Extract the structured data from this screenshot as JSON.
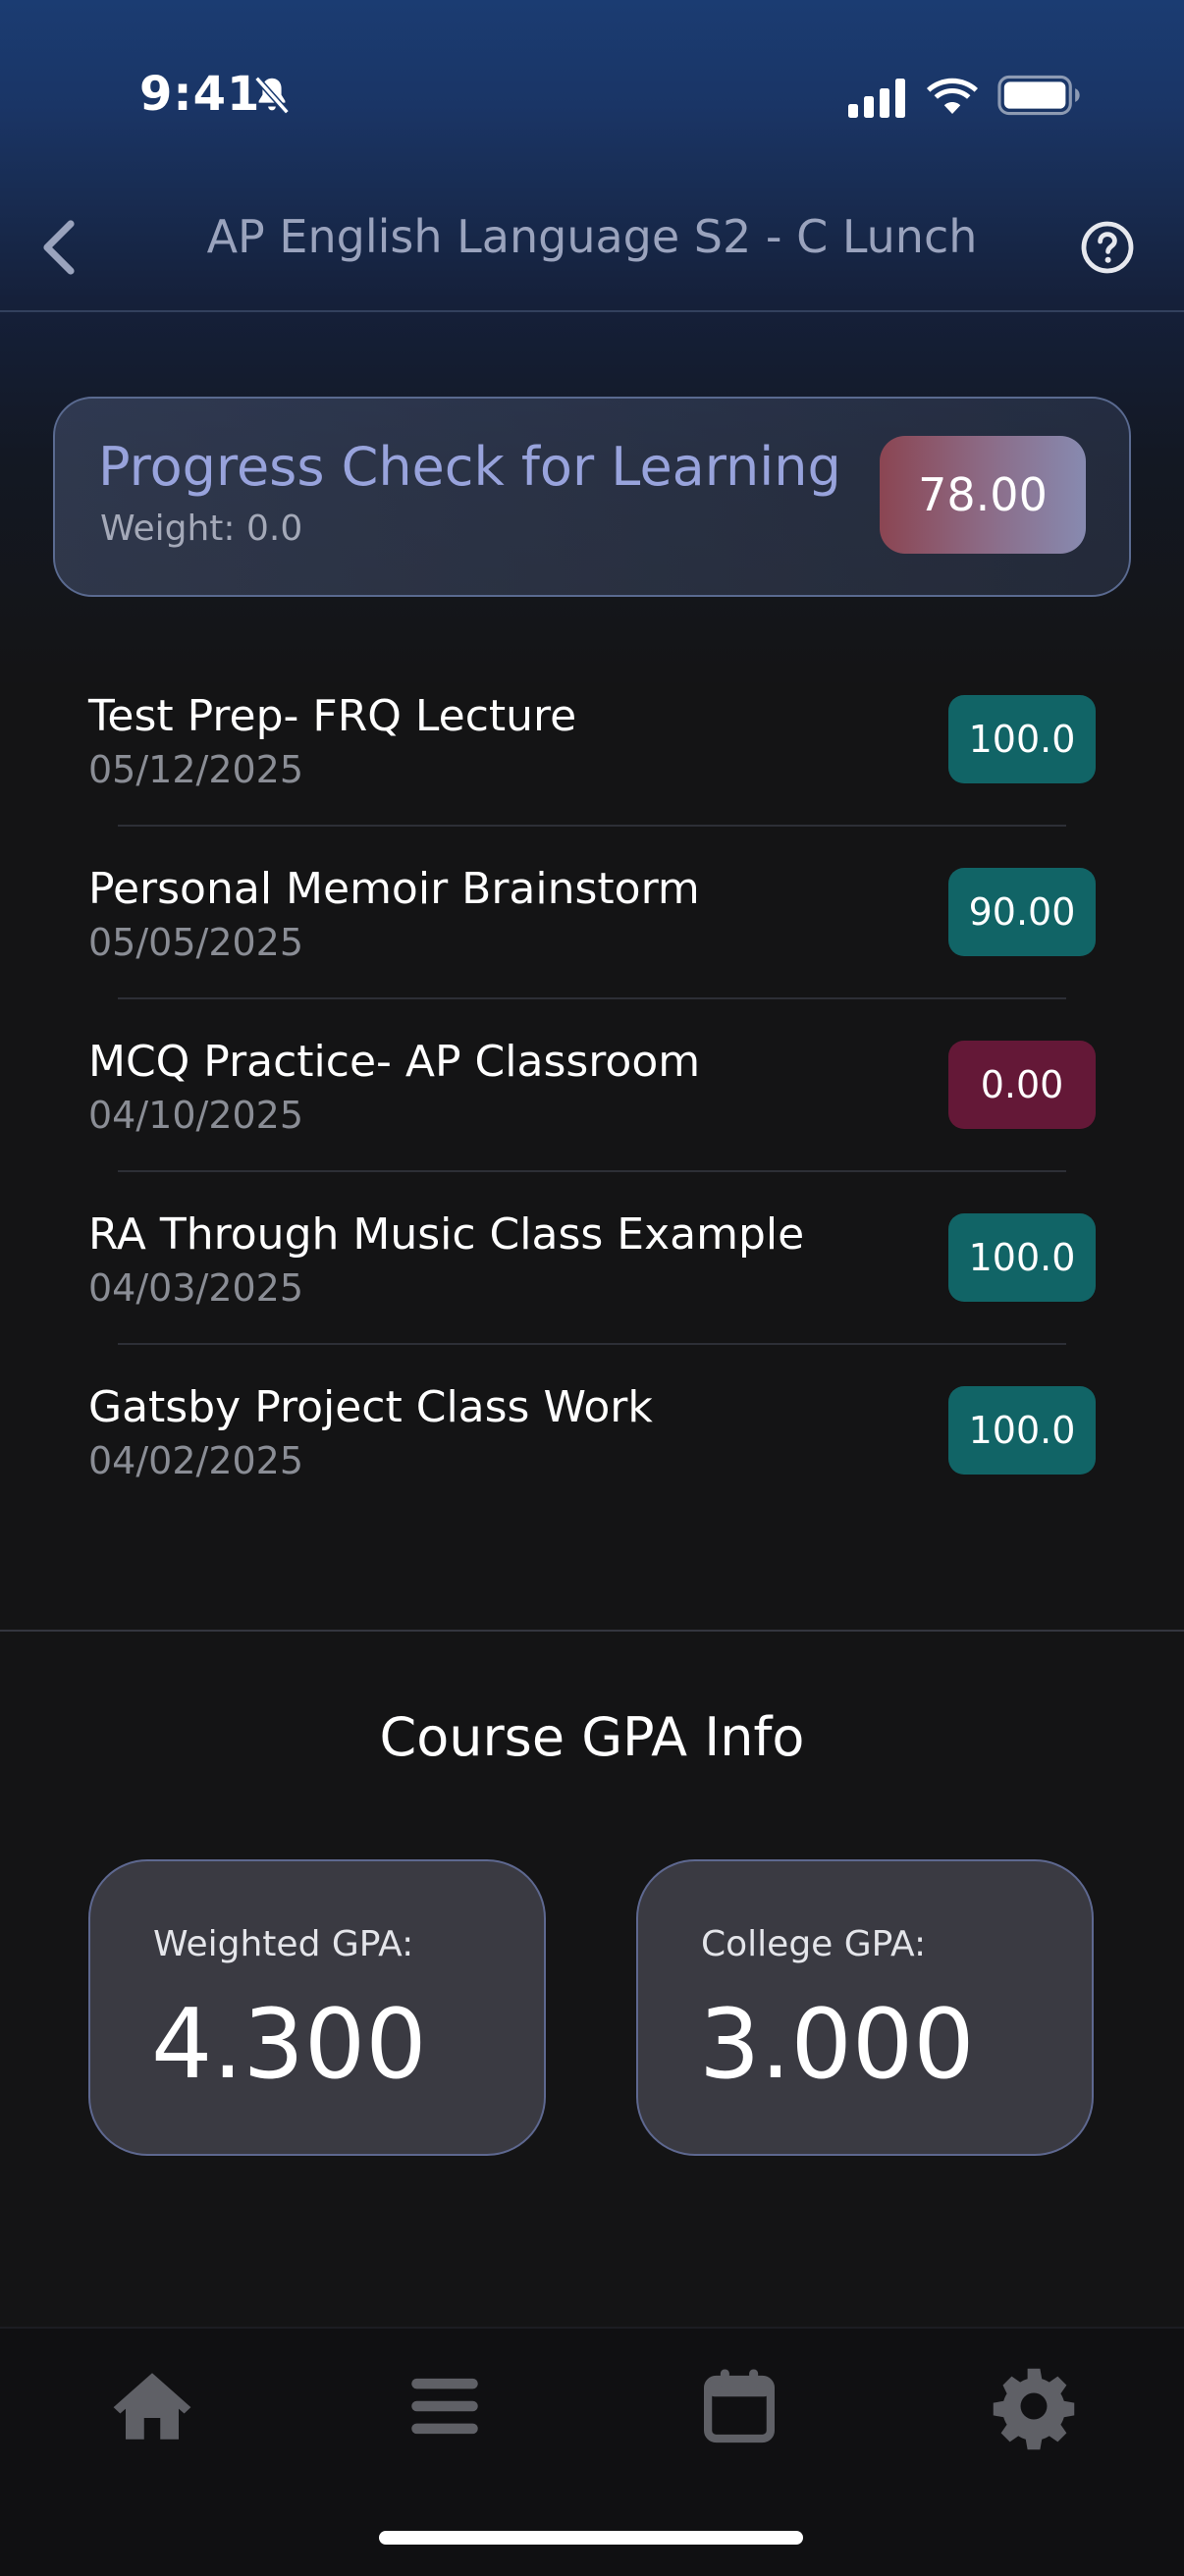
{
  "status_bar": {
    "time": "9:41"
  },
  "header": {
    "title": "AP English Language S2 - C Lunch"
  },
  "progress_card": {
    "title": "Progress Check for Learning",
    "weight": "Weight: 0.0",
    "score": "78.00"
  },
  "assignments": [
    {
      "name": "Test Prep- FRQ Lecture",
      "date": "05/12/2025",
      "score": "100.0",
      "status": "good"
    },
    {
      "name": "Personal Memoir Brainstorm",
      "date": "05/05/2025",
      "score": "90.00",
      "status": "good"
    },
    {
      "name": "MCQ Practice- AP Classroom",
      "date": "04/10/2025",
      "score": "0.00",
      "status": "bad"
    },
    {
      "name": "RA Through Music Class Example",
      "date": "04/03/2025",
      "score": "100.0",
      "status": "good"
    },
    {
      "name": "Gatsby Project Class Work",
      "date": "04/02/2025",
      "score": "100.0",
      "status": "good"
    }
  ],
  "gpa": {
    "title": "Course GPA Info",
    "weighted_label": "Weighted GPA:",
    "weighted_value": "4.300",
    "college_label": "College GPA:",
    "college_value": "3.000"
  },
  "tabs": [
    {
      "icon": "home-icon"
    },
    {
      "icon": "menu-icon"
    },
    {
      "icon": "calendar-icon"
    },
    {
      "icon": "gear-icon"
    }
  ],
  "colors": {
    "score_good": "#116466",
    "score_bad": "#641837",
    "accent_title": "#98a3dc",
    "background": "#141415"
  }
}
